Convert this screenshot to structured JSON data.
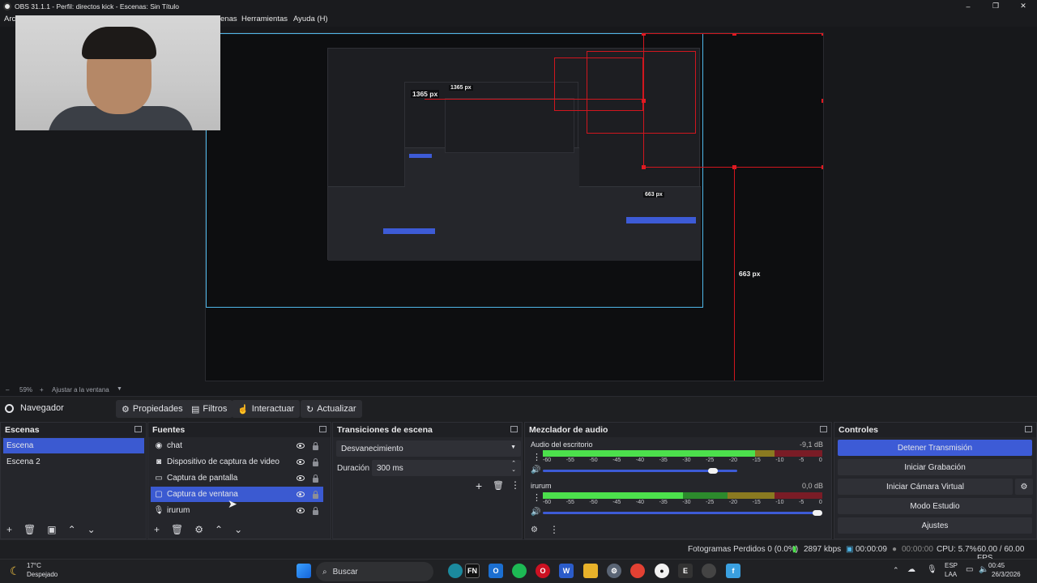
{
  "window": {
    "title": "OBS 31.1.1 - Perfil: directos kick - Escenas: Sin Título",
    "minimize": "–",
    "maximize": "❐",
    "close": "✕"
  },
  "menu": [
    "Arch",
    "enas",
    "Herramientas",
    "Ayuda (H)"
  ],
  "preview": {
    "labels": [
      "1365 px",
      "663 px",
      "663 px",
      "1365 px"
    ]
  },
  "zoom": {
    "minus": "–",
    "value": "59%",
    "plus": "+",
    "fit": "Ajustar a la ventana"
  },
  "context": {
    "navigator": "Navegador",
    "properties": "Propiedades",
    "filters": "Filtros",
    "interact": "Interactuar",
    "refresh": "Actualizar"
  },
  "scenes": {
    "title": "Escenas",
    "items": [
      "Escena",
      "Escena 2"
    ],
    "selected": 0
  },
  "sources": {
    "title": "Fuentes",
    "items": [
      {
        "label": "chat",
        "icon": "browser-icon"
      },
      {
        "label": "Dispositivo de captura de video",
        "icon": "camera-icon"
      },
      {
        "label": "Captura de pantalla",
        "icon": "monitor-icon"
      },
      {
        "label": "Captura de ventana",
        "icon": "window-icon"
      },
      {
        "label": "irurum",
        "icon": "microphone-icon"
      }
    ],
    "selected": 3
  },
  "transitions": {
    "title": "Transiciones de escena",
    "selected": "Desvanecimiento",
    "duration_label": "Duración",
    "duration_value": "300 ms"
  },
  "mixer": {
    "title": "Mezclador de audio",
    "channels": [
      {
        "name": "Audio del escritorio",
        "db": "-9,1 dB",
        "level": 0.76,
        "volume": 0.9
      },
      {
        "name": "irurum",
        "db": "0,0 dB",
        "level": 0.5,
        "volume": 1.0
      }
    ],
    "scale": [
      "-60",
      "-55",
      "-50",
      "-45",
      "-40",
      "-35",
      "-30",
      "-25",
      "-20",
      "-15",
      "-10",
      "-5",
      "0"
    ]
  },
  "controls": {
    "title": "Controles",
    "buttons": [
      "Detener Transmisión",
      "Iniciar Grabación",
      "Iniciar Cámara Virtual",
      "Modo Estudio",
      "Ajustes"
    ]
  },
  "status": {
    "dropped": "Fotogramas Perdidos 0 (0.0%)",
    "bitrate": "2897 kbps",
    "stream_time": "00:00:09",
    "rec_time": "00:00:00",
    "cpu": "CPU: 5.7%",
    "fps": "60.00 / 60.00 FPS"
  },
  "taskbar": {
    "weather_temp": "17°C",
    "weather_desc": "Despejado",
    "search": "Buscar",
    "lang": "ESP",
    "lang2": "LAA",
    "time": "00:45",
    "date": "26/3/2026"
  },
  "colors": {
    "accent": "#3d5bd6",
    "guide_red": "#d0161e",
    "guide_cyan": "#4fb6e8"
  }
}
